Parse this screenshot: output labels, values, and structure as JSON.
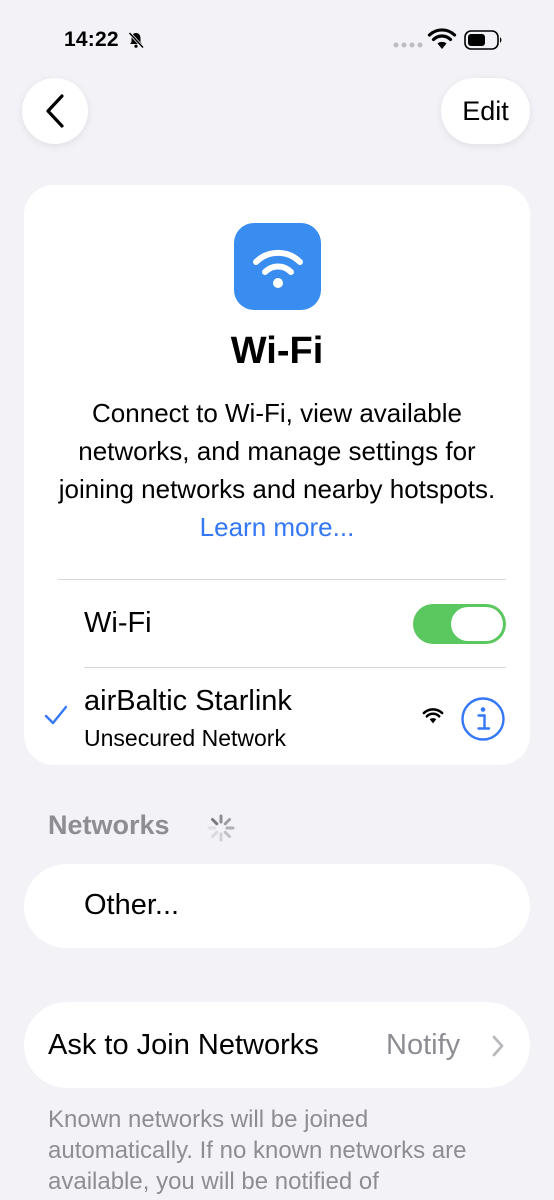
{
  "status_bar": {
    "time": "14:22",
    "icons": [
      "bell-slash-icon",
      "signal-dots-icon",
      "wifi-icon",
      "battery-icon"
    ]
  },
  "nav": {
    "back_icon": "chevron-left-icon",
    "edit_label": "Edit"
  },
  "header_card": {
    "icon": "wifi-app-icon",
    "title": "Wi-Fi",
    "description": "Connect to Wi-Fi, view available networks, and manage settings for joining networks and nearby hotspots.",
    "learn_more": "Learn more..."
  },
  "wifi_row": {
    "label": "Wi-Fi",
    "toggle_on": true
  },
  "connected_network": {
    "name": "airBaltic Starlink",
    "subtitle": "Unsecured Network",
    "check_icon": "checkmark-icon",
    "signal_icon": "wifi-icon",
    "info_icon": "info-circle-icon"
  },
  "networks_section": {
    "header": "Networks",
    "spinner_icon": "spinner-icon",
    "other_label": "Other..."
  },
  "ask_to_join": {
    "label": "Ask to Join Networks",
    "value": "Notify",
    "chevron_icon": "chevron-right-icon"
  },
  "footer": {
    "text": "Known networks will be joined automatically. If no known networks are available, you will be notified of"
  },
  "colors": {
    "accent": "#3478f6",
    "toggle_on": "#5bc85f",
    "secondary_text": "#8d8d93",
    "background": "#f2f2f7"
  }
}
